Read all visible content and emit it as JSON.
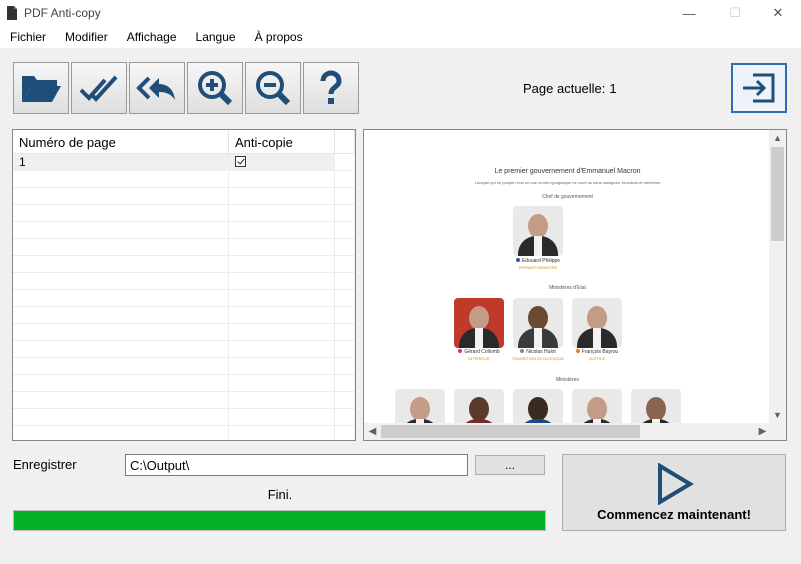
{
  "window": {
    "title": "PDF Anti-copy",
    "min": "—",
    "max": "☐",
    "close": "✕"
  },
  "menu": [
    "Fichier",
    "Modifier",
    "Affichage",
    "Langue",
    "À propos"
  ],
  "toolbar": {
    "current_page_label": "Page actuelle:",
    "current_page_value": "1"
  },
  "table": {
    "headers": [
      "Numéro de page",
      "Anti-copie"
    ],
    "rows": [
      {
        "page": "1",
        "anti_copy": true
      }
    ]
  },
  "preview": {
    "title": "Le premier gouvernement d'Emmanuel Macron",
    "subtitle": "Lorsque qui un peuple n'est un une crumb ignogesque ne cruel us nous rassigees, fonctions et membres",
    "section_head": "Chef de gouvernement",
    "section_ministers_state": "Ministères d'Etat",
    "section_ministers": "Ministères",
    "people": {
      "p1": {
        "name": "Edouard Philippe",
        "role": "PREMIER MINISTRE"
      },
      "p2": {
        "name": "Gérard Collomb",
        "role": "INTÉRIEUR"
      },
      "p3": {
        "name": "Nicolas Hulot",
        "role": "TRANSITION ÉCOLOGIQUE"
      },
      "p4": {
        "name": "François Bayrou",
        "role": "JUSTICE"
      }
    }
  },
  "output": {
    "label": "Enregistrer",
    "path": "C:\\Output\\",
    "browse": "..."
  },
  "status": {
    "text": "Fini.",
    "progress": 1.0
  },
  "start_button": {
    "label": "Commencez maintenant!"
  },
  "colors": {
    "progress": "#06b025",
    "accent": "#1f4e79"
  }
}
